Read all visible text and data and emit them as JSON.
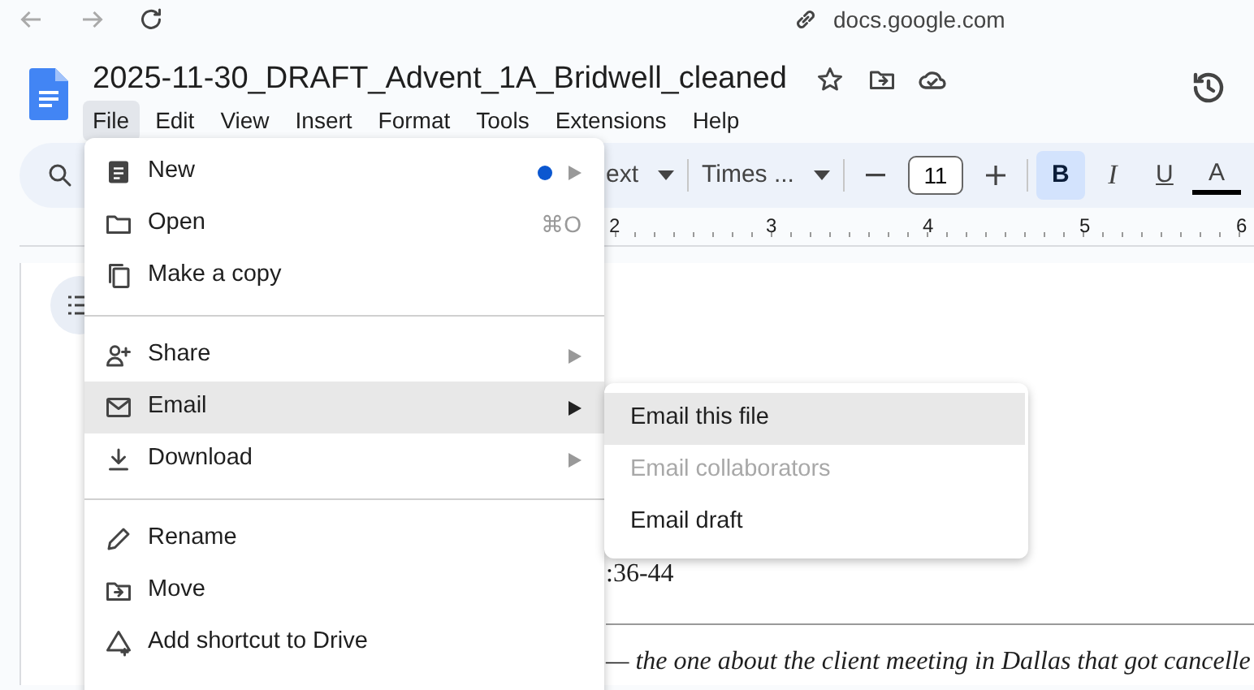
{
  "browser": {
    "url": "docs.google.com"
  },
  "document": {
    "title": "2025-11-30_DRAFT_Advent_1A_Bridwell_cleaned"
  },
  "menubar": [
    {
      "label": "File",
      "selected": true
    },
    {
      "label": "Edit",
      "selected": false
    },
    {
      "label": "View",
      "selected": false
    },
    {
      "label": "Insert",
      "selected": false
    },
    {
      "label": "Format",
      "selected": false
    },
    {
      "label": "Tools",
      "selected": false
    },
    {
      "label": "Extensions",
      "selected": false
    },
    {
      "label": "Help",
      "selected": false
    }
  ],
  "toolbar": {
    "style": "ext",
    "font": "Times ...",
    "font_size": "11",
    "format_buttons": [
      {
        "label": "B",
        "selected": true
      },
      {
        "label": "I",
        "selected": false
      },
      {
        "label": "U",
        "selected": false
      },
      {
        "label": "A",
        "selected": false
      }
    ]
  },
  "ruler": [
    "2",
    "3",
    "4",
    "5",
    "6"
  ],
  "page_lines": [
    {
      "text": ":36-44",
      "italic": false
    },
    {
      "text": "— the one about the client meeting in Dallas that got cancelle",
      "italic": true
    }
  ],
  "file_menu": [
    {
      "kind": "item",
      "label": "New",
      "highlighted": false,
      "submenu": true,
      "dot": true
    },
    {
      "kind": "item",
      "label": "Open",
      "highlighted": false,
      "submenu": false,
      "shortcut": "⌘O"
    },
    {
      "kind": "item",
      "label": "Make a copy",
      "highlighted": false,
      "submenu": false
    },
    {
      "kind": "divider"
    },
    {
      "kind": "item",
      "label": "Share",
      "highlighted": false,
      "submenu": true
    },
    {
      "kind": "item",
      "label": "Email",
      "highlighted": true,
      "submenu": true
    },
    {
      "kind": "item",
      "label": "Download",
      "highlighted": false,
      "submenu": true
    },
    {
      "kind": "divider"
    },
    {
      "kind": "item",
      "label": "Rename",
      "highlighted": false,
      "submenu": false
    },
    {
      "kind": "item",
      "label": "Move",
      "highlighted": false,
      "submenu": false
    },
    {
      "kind": "item",
      "label": "Add shortcut to Drive",
      "highlighted": false,
      "submenu": false
    }
  ],
  "email_submenu": [
    {
      "label": "Email this file",
      "highlighted": true,
      "disabled": false
    },
    {
      "label": "Email collaborators",
      "highlighted": false,
      "disabled": true
    },
    {
      "label": "Email draft",
      "highlighted": false,
      "disabled": false
    }
  ]
}
